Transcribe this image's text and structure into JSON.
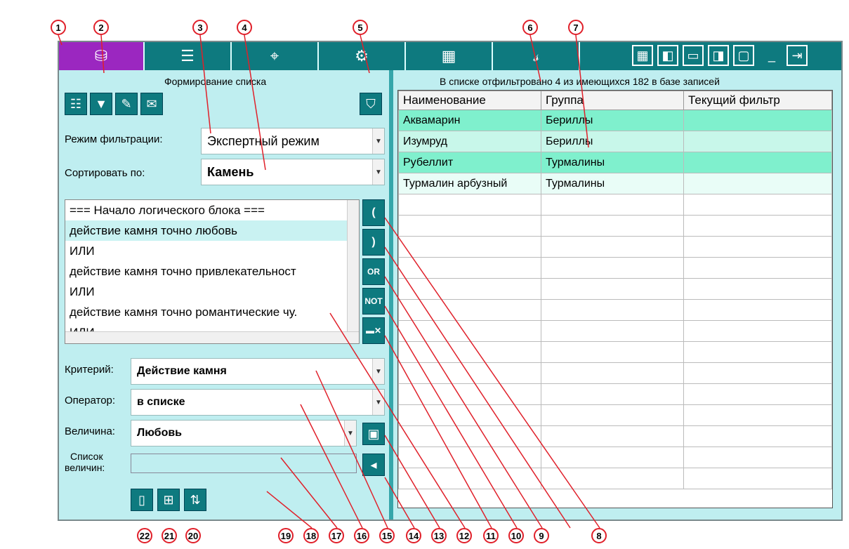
{
  "callouts_top": [
    "1",
    "2",
    "3",
    "4",
    "5",
    "6",
    "7"
  ],
  "callouts_bottom": [
    "22",
    "21",
    "20",
    "19",
    "18",
    "17",
    "16",
    "15",
    "14",
    "13",
    "12",
    "11",
    "10",
    "9",
    "8"
  ],
  "left": {
    "title": "Формирование списка",
    "filter_mode_label": "Режим фильтрации:",
    "filter_mode_value": "Экспертный режим",
    "sort_label": "Сортировать по:",
    "sort_value": "Камень",
    "logic_items": [
      "=== Начало логического блока ===",
      "действие камня точно любовь",
      "ИЛИ",
      "действие камня точно привлекательност",
      "ИЛИ",
      "действие камня точно романтические чу.",
      "ИЛИ"
    ],
    "ops": [
      "(",
      ")",
      "OR",
      "NOT",
      "▬✕"
    ],
    "criterion_label": "Критерий:",
    "criterion_value": "Действие камня",
    "operator_label": "Оператор:",
    "operator_value": "в списке",
    "value_label": "Величина:",
    "value_value": "Любовь",
    "values_list_label_1": "Список",
    "values_list_label_2": "величин:",
    "values_list_value": ""
  },
  "right": {
    "status": "В списке отфильтровано 4 из имеющихся 182 в базе записей",
    "columns": [
      "Наименование",
      "Группа",
      "Текущий фильтр"
    ],
    "rows": [
      [
        "Аквамарин",
        "Бериллы",
        ""
      ],
      [
        "Изумруд",
        "Бериллы",
        ""
      ],
      [
        "Рубеллит",
        "Турмалины",
        ""
      ],
      [
        "Турмалин арбузный",
        "Турмалины",
        ""
      ]
    ]
  },
  "colors": {
    "accent": "#0e7a7f",
    "active_tab": "#9b27c0",
    "panel": "#bfeef0",
    "callout": "#e0202a"
  }
}
